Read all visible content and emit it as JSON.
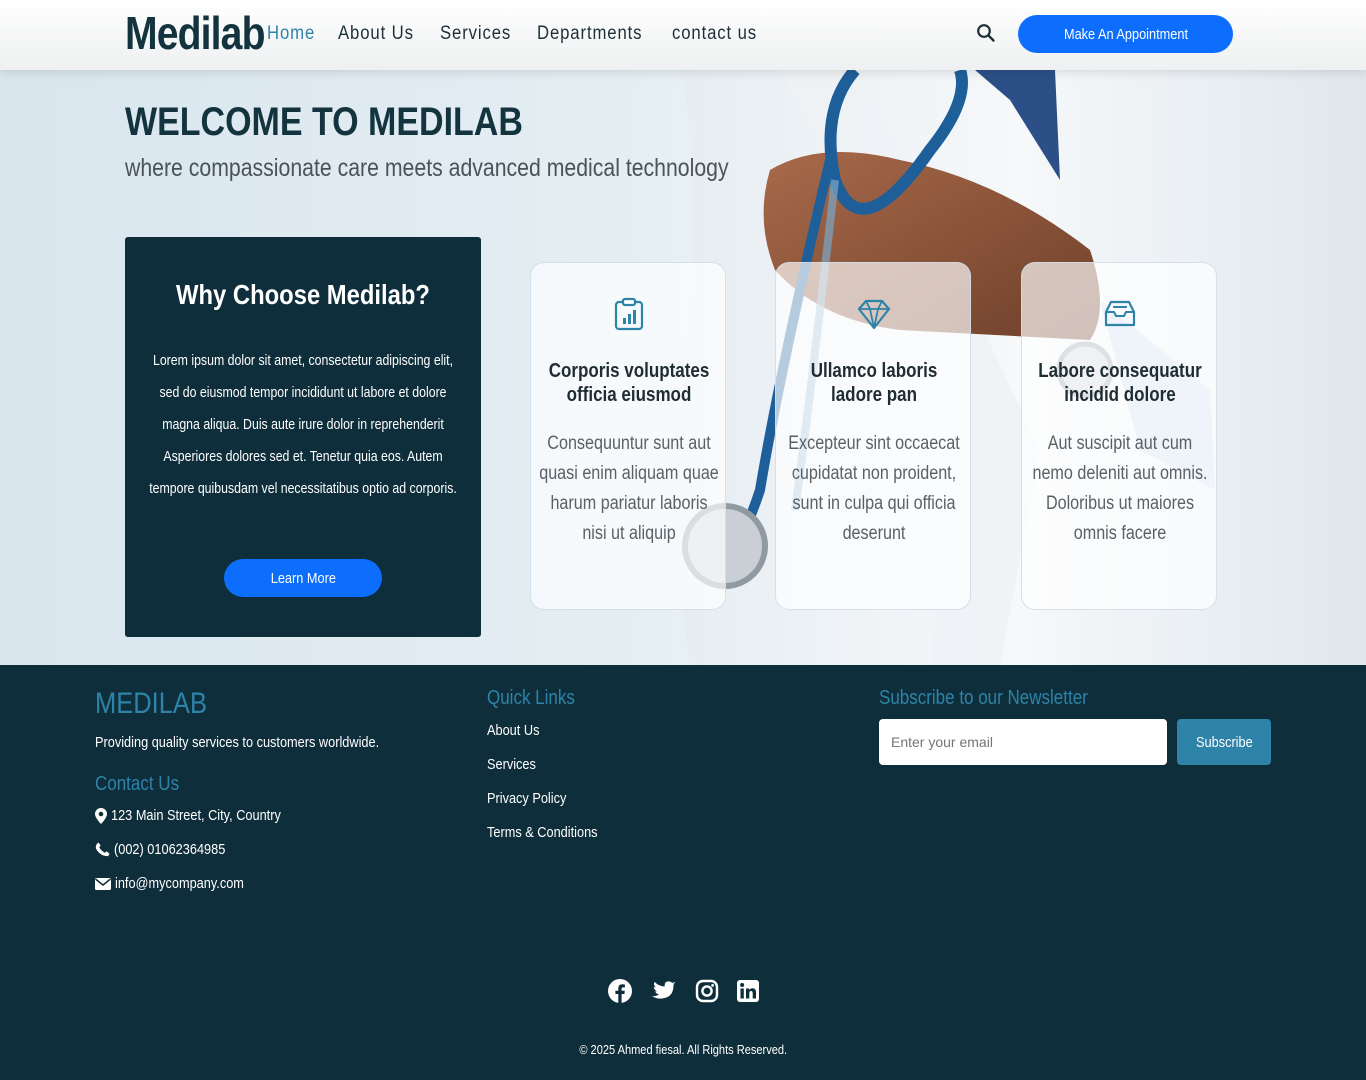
{
  "header": {
    "logo": "Medilab",
    "nav": [
      "Home",
      "About Us",
      "Services",
      "Departments",
      "contact us"
    ],
    "appointment_label": "Make An Appointment"
  },
  "hero": {
    "title": "WELCOME TO MEDILAB",
    "tagline": "where compassionate care meets advanced medical technology",
    "why": {
      "title": "Why Choose Medilab?",
      "text": "Lorem ipsum dolor sit amet, consectetur adipiscing elit, sed do eiusmod tempor incididunt ut labore et dolore magna aliqua. Duis aute irure dolor in reprehenderit Asperiores dolores sed et. Tenetur quia eos. Autem tempore quibusdam vel necessitatibus optio ad corporis.",
      "button_label": "Learn More"
    },
    "cards": [
      {
        "icon": "clipboard-chart-icon",
        "title": "Corporis voluptates officia eiusmod",
        "text": "Consequuntur sunt aut quasi enim aliquam quae harum pariatur laboris nisi ut aliquip"
      },
      {
        "icon": "gem-icon",
        "title": "Ullamco laboris ladore pan",
        "text": "Excepteur sint occaecat cupidatat non proident, sunt in culpa qui officia deserunt"
      },
      {
        "icon": "inbox-icon",
        "title": "Labore consequatur incidid dolore",
        "text": "Aut suscipit aut cum nemo deleniti aut omnis. Doloribus ut maiores omnis facere"
      }
    ]
  },
  "footer": {
    "brand": "MEDILAB",
    "description": "Providing quality services to customers worldwide.",
    "contact_heading": "Contact Us",
    "address": "123 Main Street, City, Country",
    "phone": "(002) 01062364985",
    "email": "info@mycompany.com",
    "quick_links_heading": "Quick Links",
    "quick_links": [
      "About Us",
      "Services",
      "Privacy Policy",
      "Terms & Conditions"
    ],
    "newsletter_heading": "Subscribe to our Newsletter",
    "newsletter_placeholder": "Enter your email",
    "subscribe_label": "Subscribe",
    "social": [
      "facebook-icon",
      "twitter-icon",
      "instagram-icon",
      "linkedin-icon"
    ],
    "copyright": "© 2025 Ahmed fiesal. All Rights Reserved."
  },
  "colors": {
    "dark_navy": "#0f2e3b",
    "accent_blue": "#0d6efd",
    "teal": "#2d83a8"
  }
}
